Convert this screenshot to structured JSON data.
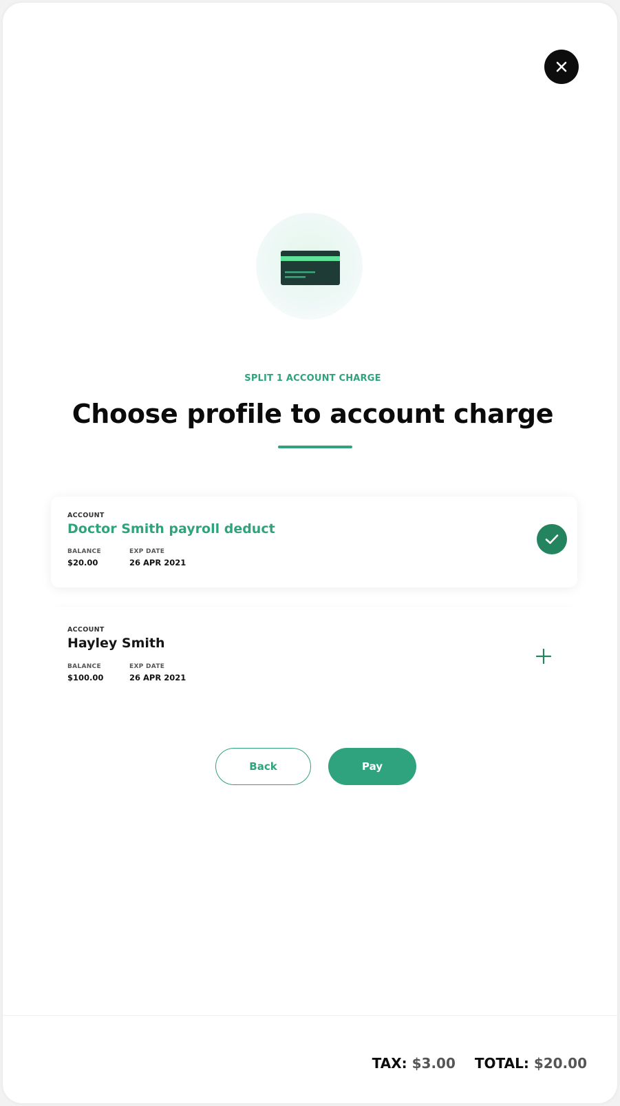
{
  "eyebrow": "SPLIT 1 ACCOUNT CHARGE",
  "title": "Choose profile to account charge",
  "accounts": [
    {
      "label": "ACCOUNT",
      "name": "Doctor Smith payroll deduct",
      "balance_label": "BALANCE",
      "balance": "$20.00",
      "exp_label": "EXP DATE",
      "exp": "26 APR 2021",
      "selected": true,
      "action_icon": "checkmark-icon"
    },
    {
      "label": "ACCOUNT",
      "name": "Hayley Smith",
      "balance_label": "BALANCE",
      "balance": "$100.00",
      "exp_label": "EXP DATE",
      "exp": "26 APR 2021",
      "selected": false,
      "action_icon": "plus-icon"
    }
  ],
  "buttons": {
    "back": "Back",
    "pay": "Pay"
  },
  "totals": {
    "tax_label": "TAX:",
    "tax_value": "$3.00",
    "total_label": "TOTAL:",
    "total_value": "$20.00"
  },
  "colors": {
    "accent": "#2fa37e",
    "accent_dark": "#23845f",
    "card_dark": "#1f3b35",
    "text": "#0b0b0b"
  },
  "icons": {
    "close": "close-icon",
    "illustration": "credit-card-icon"
  }
}
